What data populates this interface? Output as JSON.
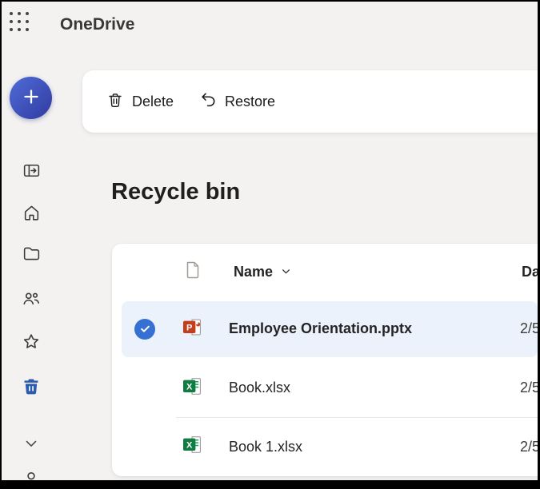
{
  "app": {
    "name": "OneDrive"
  },
  "toolbar": {
    "delete_label": "Delete",
    "restore_label": "Restore"
  },
  "page": {
    "title": "Recycle bin"
  },
  "table": {
    "header": {
      "name": "Name",
      "date": "Da"
    },
    "rows": [
      {
        "name": "Employee Orientation.pptx",
        "date": "2/5",
        "type": "powerpoint",
        "selected": true
      },
      {
        "name": "Book.xlsx",
        "date": "2/5",
        "type": "excel",
        "selected": false
      },
      {
        "name": "Book 1.xlsx",
        "date": "2/5",
        "type": "excel",
        "selected": false
      }
    ]
  },
  "sidebar": {
    "add_icon": "plus-icon",
    "items": [
      {
        "icon": "panel-toggle-icon",
        "active": false
      },
      {
        "icon": "home-icon",
        "active": false
      },
      {
        "icon": "folder-icon",
        "active": false
      },
      {
        "icon": "people-icon",
        "active": false
      },
      {
        "icon": "star-icon",
        "active": false
      },
      {
        "icon": "trash-icon",
        "active": true
      },
      {
        "icon": "chevron-down-icon",
        "active": false
      },
      {
        "icon": "person-icon",
        "active": false
      }
    ]
  },
  "colors": {
    "background": "#f3f2f1",
    "accent_check_blue": "#3570d2",
    "trash_active_blue": "#2d5cae",
    "selected_row_bg": "#ebf2fb",
    "powerpoint_red": "#c43e1c",
    "excel_green": "#107c41",
    "add_button_gradient_start": "#4b64cf",
    "add_button_gradient_end": "#3340a6"
  }
}
